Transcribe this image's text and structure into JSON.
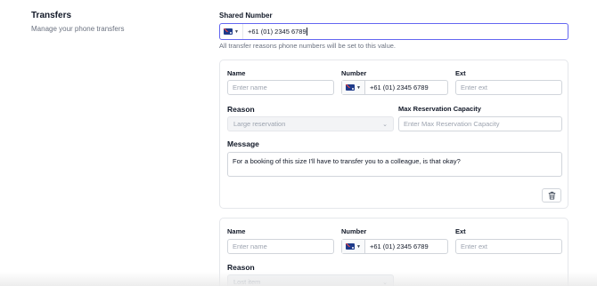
{
  "section": {
    "title": "Transfers",
    "subtitle": "Manage your phone transfers"
  },
  "shared": {
    "label": "Shared Number",
    "value": "+61 (01) 2345 6789",
    "help": "All transfer reasons phone numbers will be set to this value.",
    "flag_icon": "australia-flag-icon"
  },
  "transfers": [
    {
      "name_label": "Name",
      "name_placeholder": "Enter name",
      "number_label": "Number",
      "number_value": "+61 (01) 2345 6789",
      "ext_label": "Ext",
      "ext_placeholder": "Enter ext",
      "reason_label": "Reason",
      "reason_value": "Large reservation",
      "capacity_label": "Max Reservation Capacity",
      "capacity_placeholder": "Enter Max Reservation Capacity",
      "message_label": "Message",
      "message_value": "For a booking of this size I'll have to transfer you to a colleague, is that okay?",
      "delete_icon": "trash-icon"
    },
    {
      "name_label": "Name",
      "name_placeholder": "Enter name",
      "number_label": "Number",
      "number_value": "+61 (01) 2345 6789",
      "ext_label": "Ext",
      "ext_placeholder": "Enter ext",
      "reason_label": "Reason",
      "reason_value": "Lost item"
    }
  ],
  "colors": {
    "accent": "#6366f1",
    "border": "#d1d5db",
    "muted_text": "#6b7280",
    "placeholder": "#9ca3af"
  }
}
